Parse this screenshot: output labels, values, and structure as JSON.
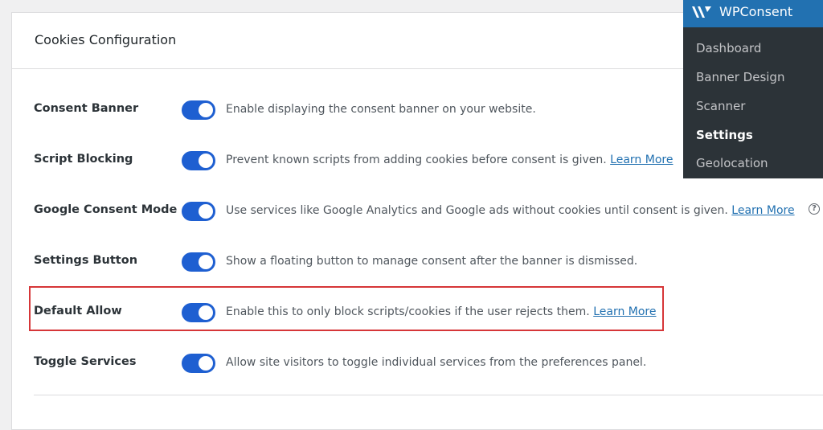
{
  "card": {
    "title": "Cookies Configuration"
  },
  "settings": [
    {
      "label": "Consent Banner",
      "enabled": true,
      "description": "Enable displaying the consent banner on your website.",
      "link": ""
    },
    {
      "label": "Script Blocking",
      "enabled": true,
      "description": "Prevent known scripts from adding cookies before consent is given.",
      "link": "Learn More"
    },
    {
      "label": "Google Consent Mode",
      "enabled": true,
      "description": "Use services like Google Analytics and Google ads without cookies until consent is given.",
      "link": "Learn More",
      "help_icon": "question-circle-icon",
      "help_glyph": "?"
    },
    {
      "label": "Settings Button",
      "enabled": true,
      "description": "Show a floating button to manage consent after the banner is dismissed.",
      "link": ""
    },
    {
      "label": "Default Allow",
      "enabled": true,
      "description": "Enable this to only block scripts/cookies if the user rejects them.",
      "link": "Learn More"
    },
    {
      "label": "Toggle Services",
      "enabled": true,
      "description": "Allow site visitors to toggle individual services from the preferences panel.",
      "link": ""
    }
  ],
  "menu": {
    "title": "WPConsent",
    "logo_icon": "wpconsent-logo-icon",
    "items": [
      {
        "label": "Dashboard",
        "active": false
      },
      {
        "label": "Banner Design",
        "active": false
      },
      {
        "label": "Scanner",
        "active": false
      },
      {
        "label": "Settings",
        "active": true
      },
      {
        "label": "Geolocation",
        "active": false
      }
    ]
  },
  "colors": {
    "toggle_on": "#1e5fd1",
    "link": "#2271b1",
    "highlight_border": "#d63638",
    "menu_bg": "#2c3338",
    "menu_header_bg": "#2271b1"
  }
}
